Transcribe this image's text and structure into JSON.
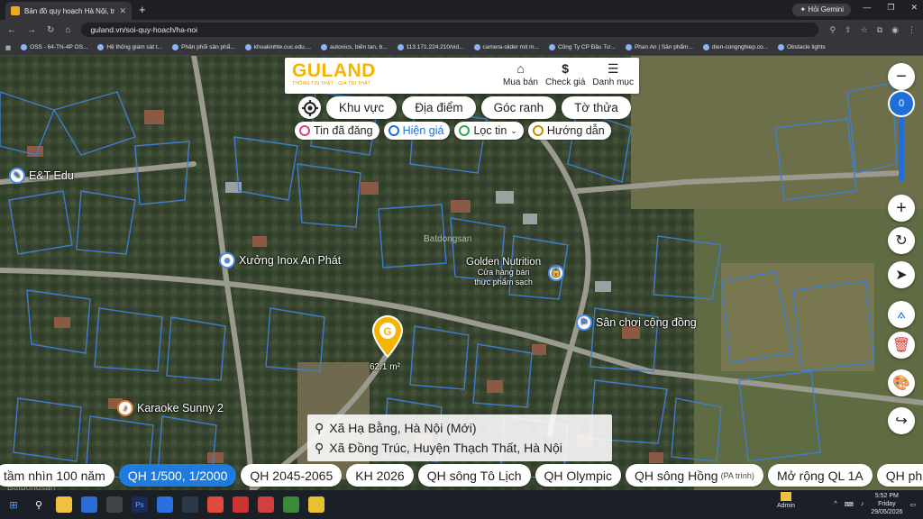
{
  "browser": {
    "tab_title": "Bản đồ quy hoạch Hà Nội, tra c...",
    "new_tab": "+",
    "gemini": "Hỏi Gemini",
    "url": "guland.vn/soi-quy-hoach/ha-noi",
    "bookmarks": [
      "OSS - 64-TN-4P OS...",
      "Hệ thống giám sát t...",
      "Phân phối sản phẩ...",
      "khoakinhte.cuc.edu....",
      "autonics, biến tan, b...",
      "113.171.224.210/vid...",
      "camera-slider mit m...",
      "Công Ty CP Đầu Tư...",
      "Phan An | Sản phẩm...",
      "dien-congnghiep.co...",
      "Obstacle lights"
    ]
  },
  "header": {
    "logo_name": "GULAND",
    "logo_tagline": "THÔNG TIN THẬT · GIÁ TRỊ THẬT",
    "nav": [
      {
        "label": "Mua bán",
        "icon": "house-icon"
      },
      {
        "label": "Check giá",
        "icon": "dollar-icon"
      },
      {
        "label": "Danh mục",
        "icon": "menu-icon"
      }
    ]
  },
  "filters": {
    "main": [
      "Khu vực",
      "Địa điểm",
      "Góc ranh",
      "Tờ thửa"
    ],
    "secondary": [
      {
        "label": "Tin đã đăng",
        "color": "#e0407a"
      },
      {
        "label": "Hiện giá",
        "color": "#1e6fd9"
      },
      {
        "label": "Lọc tin",
        "color": "#2aa84a"
      },
      {
        "label": "Hướng dẫn",
        "color": "#c98a00"
      }
    ]
  },
  "map": {
    "zoom_value": "0",
    "area_label": "62.1 m²",
    "watermark": "Batdongsan",
    "pois": [
      {
        "label": "E&T Edu"
      },
      {
        "label": "Xưởng Inox An Phát"
      },
      {
        "label": "Golden Nutrition",
        "sub1": "Cửa hàng bán",
        "sub2": "thực phẩm sạch"
      },
      {
        "label": "Sân chơi cộng đồng"
      },
      {
        "label": "Karaoke Sunny 2"
      }
    ],
    "footer_watermark": "Batdongsan",
    "footer_watermark_sub": "by PropertyGuru"
  },
  "address": {
    "line1": "Xã Hạ Bằng, Hà Nội (Mới)",
    "line2": "Xã Đồng Trúc, Huyện Thạch Thất, Hà Nội"
  },
  "layers": [
    {
      "label": "tầm nhìn 100 năm"
    },
    {
      "label": "QH 1/500, 1/2000",
      "active": true
    },
    {
      "label": "QH 2045-2065"
    },
    {
      "label": "KH 2026"
    },
    {
      "label": "QH sông Tô Lịch"
    },
    {
      "label": "QH Olympic"
    },
    {
      "label": "QH sông Hồng",
      "sub": "(PA trình)"
    },
    {
      "label": "Mở rộng QL 1A"
    },
    {
      "label": "QH phân l"
    }
  ],
  "taskbar": {
    "user": "Admin",
    "time": "5:52 PM",
    "day": "Friday",
    "date": "29/05/2026"
  },
  "colors": {
    "accent": "#1e6fd9",
    "brand": "#f5b400",
    "parcel_lines": "#3f7fd6"
  }
}
